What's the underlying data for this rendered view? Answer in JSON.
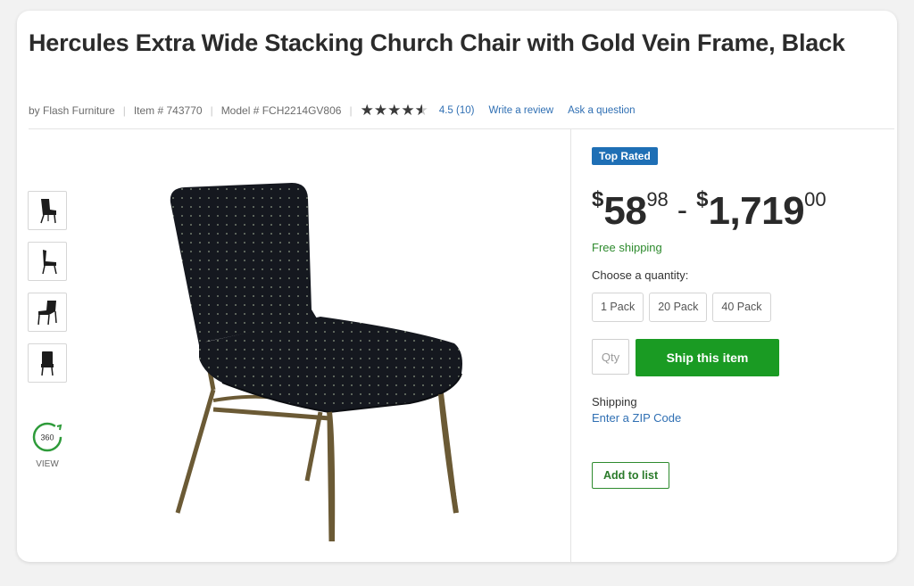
{
  "product": {
    "title": "Hercules Extra Wide Stacking Church Chair with Gold Vein Frame, Black",
    "brand": "by Flash Furniture",
    "item_number": "Item # 743770",
    "model_number": "Model # FCH2214GV806",
    "rating_text": "4.5",
    "review_count": "(10)",
    "rating_value": 4.5,
    "write_review": "Write a review",
    "ask_question": "Ask a question"
  },
  "gallery": {
    "thumbnails": [
      "chair-front-icon",
      "chair-side-icon",
      "chair-angle-icon",
      "chair-back-icon"
    ],
    "view360_icon": "360",
    "view360_label": "VIEW"
  },
  "buybox": {
    "badge": "Top Rated",
    "price_low": {
      "currency": "$",
      "whole": "58",
      "cents": "98"
    },
    "price_separator": "-",
    "price_high": {
      "currency": "$",
      "whole": "1,719",
      "cents": "00"
    },
    "free_shipping": "Free shipping",
    "quantity_label": "Choose a quantity:",
    "pack_options": [
      "1 Pack",
      "20 Pack",
      "40 Pack"
    ],
    "qty_placeholder": "Qty",
    "ship_button": "Ship this item",
    "shipping_label": "Shipping",
    "zip_link": "Enter a ZIP Code",
    "add_to_list": "Add to list"
  },
  "colors": {
    "accent_blue": "#1e6fb5",
    "link_blue": "#2f6fb3",
    "ship_green": "#1a9b23",
    "free_ship_green": "#2e8b2e"
  }
}
